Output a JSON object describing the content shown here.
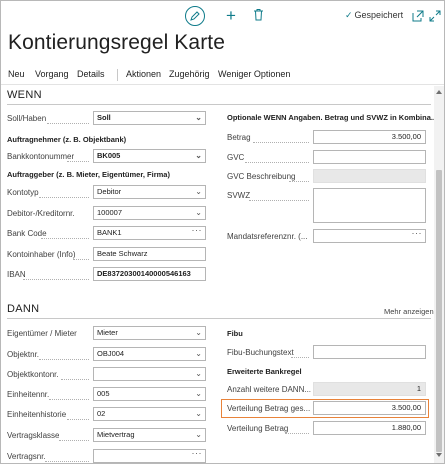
{
  "toolbar": {
    "saved_label": "Gespeichert",
    "icons": [
      "edit-icon",
      "plus-icon",
      "trash-icon",
      "popout-icon",
      "expand-icon"
    ],
    "accent_color": "#0f7b8a"
  },
  "title": "Kontierungsregel Karte",
  "actions": {
    "neu": "Neu",
    "vorgang": "Vorgang",
    "details": "Details",
    "aktionen": "Aktionen",
    "zugehoerig": "Zugehörig",
    "weniger": "Weniger Optionen"
  },
  "wenn": {
    "header": "WENN",
    "soll_haben": {
      "label": "Soll/Haben",
      "value": "Soll"
    },
    "auftragnehmer_header": "Auftragnehmer (z. B. Objektbank)",
    "bankkontonummer": {
      "label": "Bankkontonummer",
      "value": "BK005"
    },
    "auftraggeber_header": "Auftraggeber (z. B. Mieter, Eigentümer, Firma)",
    "kontotyp": {
      "label": "Kontotyp",
      "value": "Debitor"
    },
    "debitor": {
      "label": "Debitor-/Kreditornr.",
      "value": "100007"
    },
    "bank_code": {
      "label": "Bank Code",
      "value": "BANK1"
    },
    "kontoinhaber": {
      "label": "Kontoinhaber (Info)",
      "value": "Beate Schwarz"
    },
    "iban": {
      "label": "IBAN",
      "value": "DE83720300140000546163"
    },
    "optional_header": "Optionale WENN Angaben. Betrag und SVWZ in Kombina...",
    "betrag": {
      "label": "Betrag",
      "value": "3.500,00"
    },
    "gvc": {
      "label": "GVC",
      "value": ""
    },
    "gvc_beschreibung": {
      "label": "GVC Beschreibung",
      "value": ""
    },
    "svwz": {
      "label": "SVWZ",
      "value": ""
    },
    "mandatsreferenz": {
      "label": "Mandatsreferenznr. (...",
      "value": ""
    }
  },
  "dann": {
    "header": "DANN",
    "mehr_anzeigen": "Mehr anzeigen",
    "eigentuemer": {
      "label": "Eigentümer / Mieter",
      "value": "Mieter"
    },
    "objektnr": {
      "label": "Objektnr.",
      "value": "OBJ004"
    },
    "objektkontonr": {
      "label": "Objektkontonr.",
      "value": ""
    },
    "einheitennr": {
      "label": "Einheitennr.",
      "value": "005"
    },
    "einheitenhistorie": {
      "label": "Einheitenhistorie",
      "value": "02"
    },
    "vertragsklasse": {
      "label": "Vertragsklasse",
      "value": "Mietvertrag"
    },
    "vertragsnr": {
      "label": "Vertragsnr.",
      "value": ""
    },
    "fibu_header": "Fibu",
    "fibu_buchungstext": {
      "label": "Fibu-Buchungstext",
      "value": ""
    },
    "erweiterte_header": "Erweiterte Bankregel",
    "anzahl": {
      "label": "Anzahl weitere DANN...",
      "value": "1"
    },
    "verteilung_ges": {
      "label": "Verteilung Betrag ges...",
      "value": "3.500,00"
    },
    "verteilung": {
      "label": "Verteilung Betrag",
      "value": "1.880,00"
    },
    "highlight_color": "#e8833a"
  }
}
